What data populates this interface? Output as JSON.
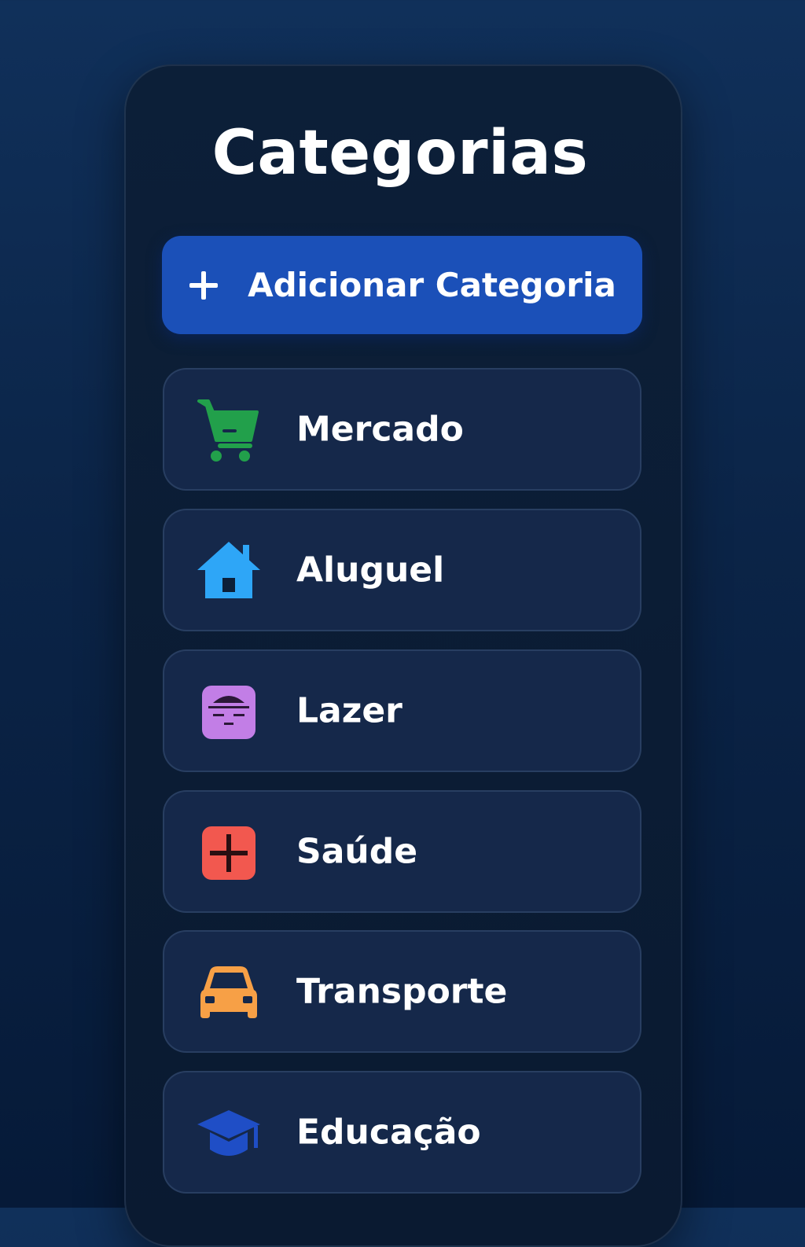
{
  "page": {
    "title": "Categorias"
  },
  "add_button": {
    "label": "Adicionar Categoria",
    "icon": "plus-icon"
  },
  "categories": [
    {
      "label": "Mercado",
      "icon": "shopping-cart-icon",
      "color": "#22a04b"
    },
    {
      "label": "Aluguel",
      "icon": "house-icon",
      "color": "#2ea6f7"
    },
    {
      "label": "Lazer",
      "icon": "leisure-face-icon",
      "color": "#c27ee6"
    },
    {
      "label": "Saúde",
      "icon": "health-cross-icon",
      "color": "#f2584f"
    },
    {
      "label": "Transporte",
      "icon": "car-icon",
      "color": "#f7a046"
    },
    {
      "label": "Educação",
      "icon": "graduation-cap-icon",
      "color": "#1f4ec6"
    }
  ],
  "colors": {
    "background": "#0b2447",
    "panel": "#0b1d35",
    "card": "#15284a",
    "button": "#1b50b8",
    "text": "#ffffff"
  }
}
